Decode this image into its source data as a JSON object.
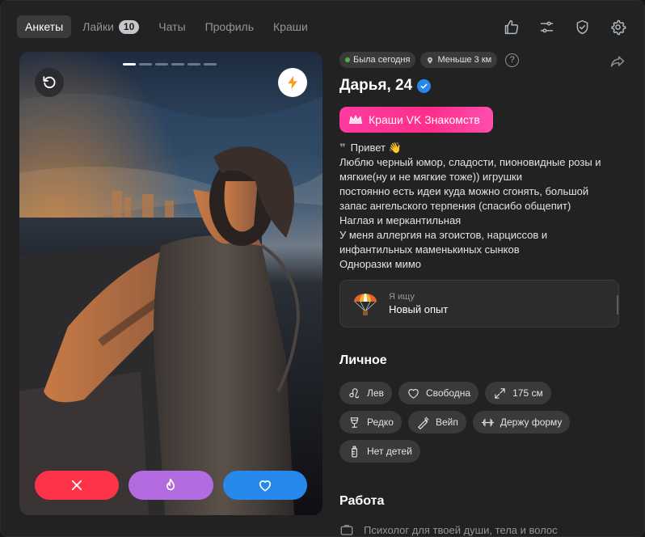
{
  "nav": {
    "tabs": [
      {
        "label": "Анкеты",
        "active": true
      },
      {
        "label": "Лайки",
        "badge": "10"
      },
      {
        "label": "Чаты"
      },
      {
        "label": "Профиль"
      },
      {
        "label": "Краши"
      }
    ],
    "icons": [
      "thumb-up-icon",
      "sliders-icon",
      "shield-check-icon",
      "gear-icon"
    ]
  },
  "photo": {
    "dots_total": 6,
    "dots_active": 1
  },
  "profile": {
    "last_seen": "Была сегодня",
    "distance": "Меньше 3 км",
    "help_label": "?",
    "name": "Дарья, 24",
    "crush_label": "Краши VK Знакомств",
    "bio_title": "Привет 👋",
    "bio_text": "Люблю черный юмор, сладости, пионовидные розы и\nмягкие(ну и не мягкие тоже)) игрушки\nпостоянно есть идеи куда можно сгонять, большой\nзапас ангельского терпения (спасибо общепит)\nНаглая и меркантильная\nУ меня аллергия на эгоистов, нарциссов и\nинфантильных маменькиных сынков\nОдноразки мимо",
    "looking_label": "Я ищу",
    "looking_value": "Новый опыт"
  },
  "personal": {
    "title": "Личное",
    "tags": [
      {
        "label": "Лев",
        "icon": "leo-icon"
      },
      {
        "label": "Свободна",
        "icon": "heart-icon"
      },
      {
        "label": "175 см",
        "icon": "height-icon"
      },
      {
        "label": "Редко",
        "icon": "wine-glass-icon"
      },
      {
        "label": "Вейп",
        "icon": "vape-icon"
      },
      {
        "label": "Держу форму",
        "icon": "dumbbell-icon"
      },
      {
        "label": "Нет детей",
        "icon": "baby-bottle-icon"
      }
    ]
  },
  "work": {
    "title": "Работа",
    "line": "Психолог для твоей души, тела и волос"
  },
  "colors": {
    "accent": "#2688eb",
    "dislike": "#ff3347",
    "super": "#b36ce0",
    "crush": "#ff2e8a"
  }
}
